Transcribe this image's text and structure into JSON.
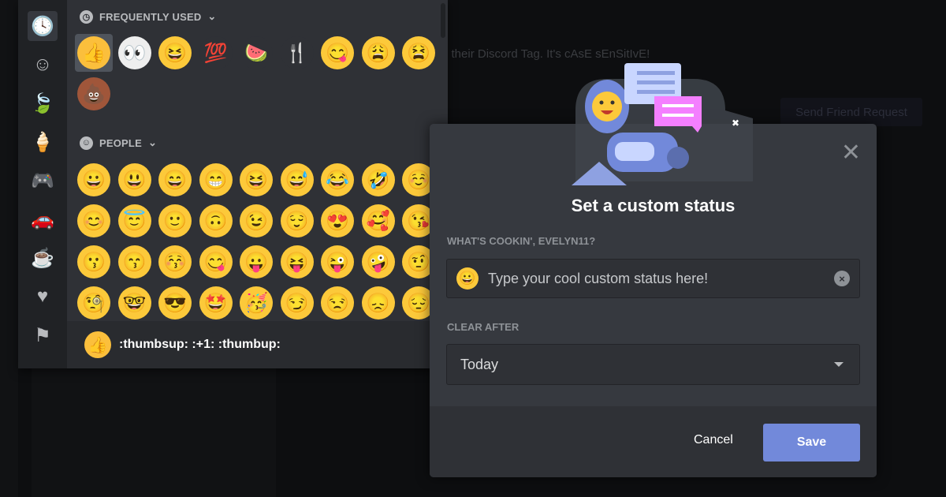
{
  "background": {
    "hint_text": "h their Discord Tag. It's cAsE sEnSitIvE!",
    "send_request_label": "Send Friend Request"
  },
  "picker": {
    "categories": [
      {
        "name": "recent",
        "glyph": "🕓"
      },
      {
        "name": "people",
        "glyph": "☺"
      },
      {
        "name": "nature",
        "glyph": "🍃"
      },
      {
        "name": "food",
        "glyph": "🍦"
      },
      {
        "name": "activity",
        "glyph": "🎮"
      },
      {
        "name": "travel",
        "glyph": "🚗"
      },
      {
        "name": "objects",
        "glyph": "☕"
      },
      {
        "name": "symbols",
        "glyph": "♥"
      },
      {
        "name": "flags",
        "glyph": "⚑"
      }
    ],
    "frequent_header": "FREQUENTLY USED",
    "people_header": "PEOPLE",
    "frequent": [
      {
        "e": "👍",
        "c": "#fbbf3c"
      },
      {
        "e": "👀",
        "c": "#eeeeee"
      },
      {
        "e": "😆",
        "c": "#fcc93a"
      },
      {
        "e": "💯",
        "c": "#2f3136"
      },
      {
        "e": "🍉",
        "c": "#2f3136"
      },
      {
        "e": "🍴",
        "c": "#2f3136"
      },
      {
        "e": "😋",
        "c": "#fcc93a"
      },
      {
        "e": "😩",
        "c": "#fcc93a"
      },
      {
        "e": "😫",
        "c": "#fcc93a"
      },
      {
        "e": "💩",
        "c": "#a0563a"
      }
    ],
    "people": [
      "😀",
      "😃",
      "😄",
      "😁",
      "😆",
      "😅",
      "😂",
      "🤣",
      "☺️",
      "😊",
      "😇",
      "🙂",
      "🙃",
      "😉",
      "😌",
      "😍",
      "🥰",
      "😘",
      "😗",
      "😙",
      "😚",
      "😋",
      "😛",
      "😝",
      "😜",
      "🤪",
      "🤨",
      "🧐",
      "🤓",
      "😎",
      "🤩",
      "🥳",
      "😏",
      "😒",
      "😞",
      "😔"
    ],
    "preview": {
      "emoji": "👍",
      "text": ":thumbsup: :+1: :thumbup:"
    }
  },
  "modal": {
    "title": "Set a custom status",
    "status_label": "WHAT'S COOKIN', EVELYN11?",
    "status_emoji": "😀",
    "status_placeholder": "Type your cool custom status here!",
    "clear_label": "CLEAR AFTER",
    "clear_value": "Today",
    "cancel": "Cancel",
    "save": "Save",
    "accent": "#7289da"
  }
}
